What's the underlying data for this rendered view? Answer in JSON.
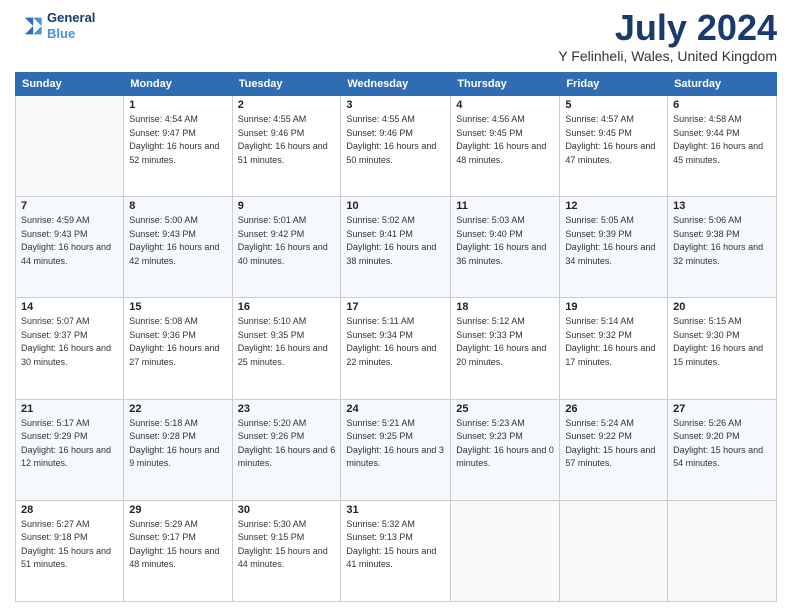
{
  "header": {
    "logo_line1": "General",
    "logo_line2": "Blue",
    "month": "July 2024",
    "location": "Y Felinheli, Wales, United Kingdom"
  },
  "weekdays": [
    "Sunday",
    "Monday",
    "Tuesday",
    "Wednesday",
    "Thursday",
    "Friday",
    "Saturday"
  ],
  "weeks": [
    [
      {
        "day": null,
        "sunrise": null,
        "sunset": null,
        "daylight": null
      },
      {
        "day": "1",
        "sunrise": "Sunrise: 4:54 AM",
        "sunset": "Sunset: 9:47 PM",
        "daylight": "Daylight: 16 hours and 52 minutes."
      },
      {
        "day": "2",
        "sunrise": "Sunrise: 4:55 AM",
        "sunset": "Sunset: 9:46 PM",
        "daylight": "Daylight: 16 hours and 51 minutes."
      },
      {
        "day": "3",
        "sunrise": "Sunrise: 4:55 AM",
        "sunset": "Sunset: 9:46 PM",
        "daylight": "Daylight: 16 hours and 50 minutes."
      },
      {
        "day": "4",
        "sunrise": "Sunrise: 4:56 AM",
        "sunset": "Sunset: 9:45 PM",
        "daylight": "Daylight: 16 hours and 48 minutes."
      },
      {
        "day": "5",
        "sunrise": "Sunrise: 4:57 AM",
        "sunset": "Sunset: 9:45 PM",
        "daylight": "Daylight: 16 hours and 47 minutes."
      },
      {
        "day": "6",
        "sunrise": "Sunrise: 4:58 AM",
        "sunset": "Sunset: 9:44 PM",
        "daylight": "Daylight: 16 hours and 45 minutes."
      }
    ],
    [
      {
        "day": "7",
        "sunrise": "Sunrise: 4:59 AM",
        "sunset": "Sunset: 9:43 PM",
        "daylight": "Daylight: 16 hours and 44 minutes."
      },
      {
        "day": "8",
        "sunrise": "Sunrise: 5:00 AM",
        "sunset": "Sunset: 9:43 PM",
        "daylight": "Daylight: 16 hours and 42 minutes."
      },
      {
        "day": "9",
        "sunrise": "Sunrise: 5:01 AM",
        "sunset": "Sunset: 9:42 PM",
        "daylight": "Daylight: 16 hours and 40 minutes."
      },
      {
        "day": "10",
        "sunrise": "Sunrise: 5:02 AM",
        "sunset": "Sunset: 9:41 PM",
        "daylight": "Daylight: 16 hours and 38 minutes."
      },
      {
        "day": "11",
        "sunrise": "Sunrise: 5:03 AM",
        "sunset": "Sunset: 9:40 PM",
        "daylight": "Daylight: 16 hours and 36 minutes."
      },
      {
        "day": "12",
        "sunrise": "Sunrise: 5:05 AM",
        "sunset": "Sunset: 9:39 PM",
        "daylight": "Daylight: 16 hours and 34 minutes."
      },
      {
        "day": "13",
        "sunrise": "Sunrise: 5:06 AM",
        "sunset": "Sunset: 9:38 PM",
        "daylight": "Daylight: 16 hours and 32 minutes."
      }
    ],
    [
      {
        "day": "14",
        "sunrise": "Sunrise: 5:07 AM",
        "sunset": "Sunset: 9:37 PM",
        "daylight": "Daylight: 16 hours and 30 minutes."
      },
      {
        "day": "15",
        "sunrise": "Sunrise: 5:08 AM",
        "sunset": "Sunset: 9:36 PM",
        "daylight": "Daylight: 16 hours and 27 minutes."
      },
      {
        "day": "16",
        "sunrise": "Sunrise: 5:10 AM",
        "sunset": "Sunset: 9:35 PM",
        "daylight": "Daylight: 16 hours and 25 minutes."
      },
      {
        "day": "17",
        "sunrise": "Sunrise: 5:11 AM",
        "sunset": "Sunset: 9:34 PM",
        "daylight": "Daylight: 16 hours and 22 minutes."
      },
      {
        "day": "18",
        "sunrise": "Sunrise: 5:12 AM",
        "sunset": "Sunset: 9:33 PM",
        "daylight": "Daylight: 16 hours and 20 minutes."
      },
      {
        "day": "19",
        "sunrise": "Sunrise: 5:14 AM",
        "sunset": "Sunset: 9:32 PM",
        "daylight": "Daylight: 16 hours and 17 minutes."
      },
      {
        "day": "20",
        "sunrise": "Sunrise: 5:15 AM",
        "sunset": "Sunset: 9:30 PM",
        "daylight": "Daylight: 16 hours and 15 minutes."
      }
    ],
    [
      {
        "day": "21",
        "sunrise": "Sunrise: 5:17 AM",
        "sunset": "Sunset: 9:29 PM",
        "daylight": "Daylight: 16 hours and 12 minutes."
      },
      {
        "day": "22",
        "sunrise": "Sunrise: 5:18 AM",
        "sunset": "Sunset: 9:28 PM",
        "daylight": "Daylight: 16 hours and 9 minutes."
      },
      {
        "day": "23",
        "sunrise": "Sunrise: 5:20 AM",
        "sunset": "Sunset: 9:26 PM",
        "daylight": "Daylight: 16 hours and 6 minutes."
      },
      {
        "day": "24",
        "sunrise": "Sunrise: 5:21 AM",
        "sunset": "Sunset: 9:25 PM",
        "daylight": "Daylight: 16 hours and 3 minutes."
      },
      {
        "day": "25",
        "sunrise": "Sunrise: 5:23 AM",
        "sunset": "Sunset: 9:23 PM",
        "daylight": "Daylight: 16 hours and 0 minutes."
      },
      {
        "day": "26",
        "sunrise": "Sunrise: 5:24 AM",
        "sunset": "Sunset: 9:22 PM",
        "daylight": "Daylight: 15 hours and 57 minutes."
      },
      {
        "day": "27",
        "sunrise": "Sunrise: 5:26 AM",
        "sunset": "Sunset: 9:20 PM",
        "daylight": "Daylight: 15 hours and 54 minutes."
      }
    ],
    [
      {
        "day": "28",
        "sunrise": "Sunrise: 5:27 AM",
        "sunset": "Sunset: 9:18 PM",
        "daylight": "Daylight: 15 hours and 51 minutes."
      },
      {
        "day": "29",
        "sunrise": "Sunrise: 5:29 AM",
        "sunset": "Sunset: 9:17 PM",
        "daylight": "Daylight: 15 hours and 48 minutes."
      },
      {
        "day": "30",
        "sunrise": "Sunrise: 5:30 AM",
        "sunset": "Sunset: 9:15 PM",
        "daylight": "Daylight: 15 hours and 44 minutes."
      },
      {
        "day": "31",
        "sunrise": "Sunrise: 5:32 AM",
        "sunset": "Sunset: 9:13 PM",
        "daylight": "Daylight: 15 hours and 41 minutes."
      },
      {
        "day": null,
        "sunrise": null,
        "sunset": null,
        "daylight": null
      },
      {
        "day": null,
        "sunrise": null,
        "sunset": null,
        "daylight": null
      },
      {
        "day": null,
        "sunrise": null,
        "sunset": null,
        "daylight": null
      }
    ]
  ]
}
